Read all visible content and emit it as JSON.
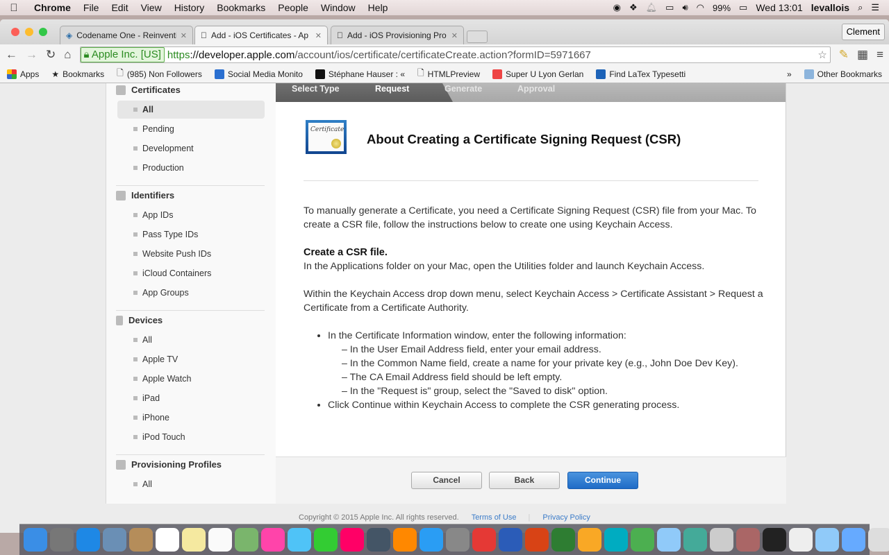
{
  "menubar": {
    "app": "Chrome",
    "items": [
      "File",
      "Edit",
      "View",
      "History",
      "Bookmarks",
      "People",
      "Window",
      "Help"
    ],
    "battery": "99%",
    "clock": "Wed 13:01",
    "user": "levallois"
  },
  "tabs": [
    {
      "title": "Codename One - Reinventi",
      "active": false
    },
    {
      "title": "Add - iOS Certificates - Ap",
      "active": true
    },
    {
      "title": "Add - iOS Provisioning Pro",
      "active": false
    }
  ],
  "profile": "Clement",
  "address": {
    "ev": "Apple Inc. [US]",
    "scheme": "https",
    "host": "://developer.apple.com",
    "path": "/account/ios/certificate/certificateCreate.action?formID=5971667"
  },
  "bookmarks": {
    "items": [
      "Apps",
      "Bookmarks",
      "(985) Non Followers",
      "Social Media Monito",
      "Stéphane Hauser : «",
      "HTMLPreview",
      "Super U Lyon Gerlan",
      "Find LaTex Typesetti"
    ],
    "more": "»",
    "other": "Other Bookmarks"
  },
  "sidebar": {
    "sections": [
      {
        "title": "Certificates",
        "items": [
          "All",
          "Pending",
          "Development",
          "Production"
        ]
      },
      {
        "title": "Identifiers",
        "items": [
          "App IDs",
          "Pass Type IDs",
          "Website Push IDs",
          "iCloud Containers",
          "App Groups"
        ]
      },
      {
        "title": "Devices",
        "items": [
          "All",
          "Apple TV",
          "Apple Watch",
          "iPad",
          "iPhone",
          "iPod Touch"
        ]
      },
      {
        "title": "Provisioning Profiles",
        "items": [
          "All"
        ]
      }
    ],
    "selected": "Certificates/All"
  },
  "steps": [
    "Select Type",
    "Request",
    "Generate",
    "Approval"
  ],
  "current_step": "Request",
  "cert_icon_text": "Certificate",
  "main": {
    "title": "About Creating a Certificate Signing Request (CSR)",
    "intro": "To manually generate a Certificate, you need a Certificate Signing Request (CSR) file from your Mac. To create a CSR file, follow the instructions below to create one using Keychain Access.",
    "subtitle": "Create a CSR file.",
    "p1": "In the Applications folder on your Mac, open the Utilities folder and launch Keychain Access.",
    "p2": "Within the Keychain Access drop down menu, select Keychain Access > Certificate Assistant > Request a Certificate from a Certificate Authority.",
    "bullet1": "In the Certificate Information window, enter the following information:",
    "sub": [
      "– In the User Email Address field, enter your email address.",
      "– In the Common Name field, create a name for your private key (e.g., John Doe Dev Key).",
      "– The CA Email Address field should be left empty.",
      "– In the \"Request is\" group, select the \"Saved to disk\" option."
    ],
    "bullet2": "Click Continue within Keychain Access to complete the CSR generating process."
  },
  "buttons": {
    "cancel": "Cancel",
    "back": "Back",
    "continue": "Continue"
  },
  "footer": {
    "copyright": "Copyright © 2015 Apple Inc. All rights reserved.",
    "terms": "Terms of Use",
    "privacy": "Privacy Policy"
  },
  "colors": {
    "primary_button": "#1f6cc7",
    "ev_green": "#2b8b21",
    "steps_done": "#5c5c5c"
  },
  "dock": [
    "Finder",
    "Launchpad",
    "Safari",
    "Preview",
    "Contacts",
    "Calendar",
    "Notes",
    "Reminders",
    "Maps",
    "Photos",
    "Messages",
    "FaceTime",
    "iTunes",
    "Time Machine",
    "iBooks",
    "App Store",
    "System Preferences",
    "Chrome",
    "Word",
    "PowerPoint",
    "Excel",
    "Outlook",
    "Codename One",
    "Network",
    "VirtualBox",
    "Network Utility",
    "Satellite",
    "Tools",
    "Tux",
    "Documents",
    "VirtualBox 2",
    "Finder 2",
    "Trash"
  ]
}
